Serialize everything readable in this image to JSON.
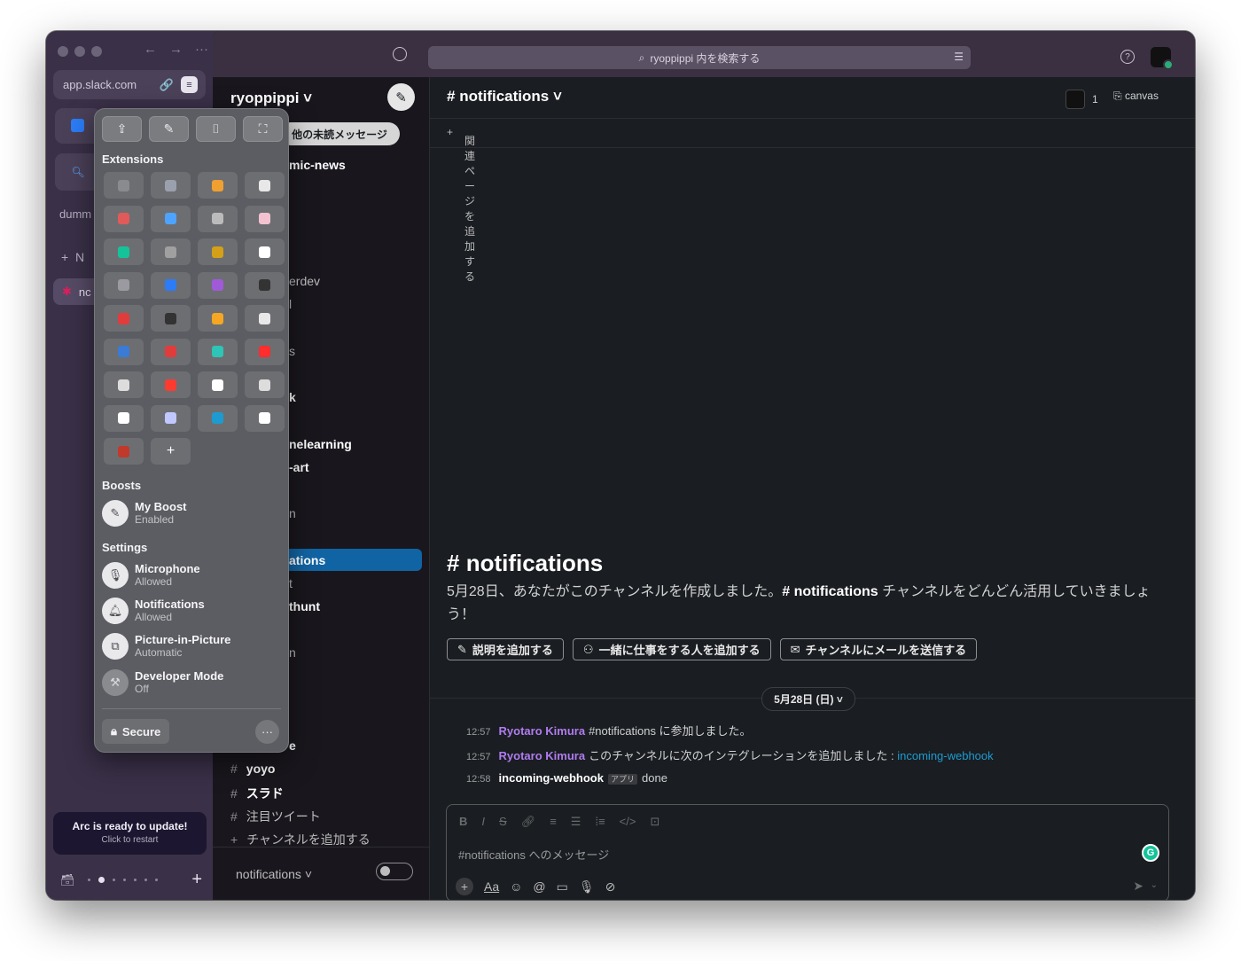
{
  "arc": {
    "url": "app.slack.com",
    "folder_label": "dumm",
    "new_tab_label": "N",
    "active_tab_label": "nc",
    "update_title": "Arc is ready to update!",
    "update_subtitle": "Click to restart"
  },
  "slack": {
    "search_placeholder": "ryoppippi 内を検索する",
    "workspace": "ryoppippi ˅",
    "unread_pill": "他の未読メッセージ",
    "sidebar_partial": [
      "mic-news",
      "erdev",
      "l",
      "s",
      "k",
      "nelearning",
      "-art",
      "n",
      "ations",
      "t",
      "thunt",
      "n",
      "e"
    ],
    "channels": [
      {
        "name": "yoyo"
      },
      {
        "name": "スラド"
      },
      {
        "name": "注目ツイート"
      }
    ],
    "add_channel": "チャンネルを追加する",
    "footer_channel": "notifications ˅",
    "channel_title": "notifications ˅",
    "member_count": "1",
    "canvas_label": "canvas",
    "bookmark_add": "関連ページを追加する",
    "intro_title": "notifications",
    "intro_text_1": "5月28日、あなたがこのチャンネルを作成しました。",
    "intro_text_ch": "notifications",
    "intro_text_2": " チャンネルをどんどん活用していきましょう！",
    "btn_description": "説明を追加する",
    "btn_add_people": "一緒に仕事をする人を追加する",
    "btn_email": "チャンネルにメールを送信する",
    "date_divider": "5月28日 (日) ˅",
    "messages": [
      {
        "time": "12:57",
        "user": "Ryotaro Kimura",
        "text": "#notifications に参加しました。"
      },
      {
        "time": "12:57",
        "user": "Ryotaro Kimura",
        "text": "このチャンネルに次のインテグレーションを追加しました : ",
        "link": "incoming-webhook"
      },
      {
        "time": "12:58",
        "user": "incoming-webhook",
        "badge": "アプリ",
        "text": "done"
      }
    ],
    "composer_placeholder": "#notifications へのメッセージ"
  },
  "popover": {
    "extensions_label": "Extensions",
    "boosts_label": "Boosts",
    "settings_label": "Settings",
    "boost": {
      "title": "My Boost",
      "status": "Enabled"
    },
    "settings": [
      {
        "title": "Microphone",
        "status": "Allowed"
      },
      {
        "title": "Notifications",
        "status": "Allowed"
      },
      {
        "title": "Picture-in-Picture",
        "status": "Automatic"
      },
      {
        "title": "Developer Mode",
        "status": "Off"
      }
    ],
    "secure_label": "Secure",
    "extension_colors": [
      "#8a8b8f",
      "#9aa0ad",
      "#f0a030",
      "#e8e8e8",
      "#e05a5a",
      "#4da3ff",
      "#bbbbbb",
      "#f2c2d0",
      "#15c39a",
      "#a0a0a0",
      "#d4a017",
      "#ffffff",
      "#9a9aa0",
      "#2b7cf6",
      "#a05ad8",
      "#333333",
      "#e03c3c",
      "#333333",
      "#f5a623",
      "#e8e8e8",
      "#3a7bd5",
      "#e03c3c",
      "#2ec4b6",
      "#ff2d2d",
      "#dddddd",
      "#ff3b30",
      "#ffffff",
      "#dddddd",
      "#ffffff",
      "#c0c8ff",
      "#1d9bd1",
      "#ffffff",
      "#c0392b"
    ]
  }
}
